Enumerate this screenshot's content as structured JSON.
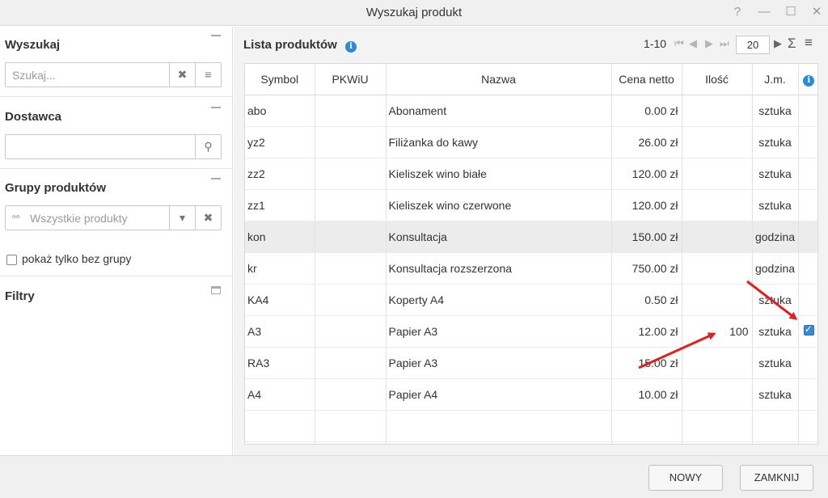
{
  "window": {
    "title": "Wyszukaj produkt",
    "help": "?",
    "minimize": "—",
    "maximize": "☐",
    "close": "✕"
  },
  "left": {
    "search": {
      "title": "Wyszukaj",
      "placeholder": "Szukaj...",
      "clear": "✖",
      "menu": "≡"
    },
    "supplier": {
      "title": "Dostawca",
      "value": "",
      "search": "⚲"
    },
    "groups": {
      "title": "Grupy produktów",
      "value": "Wszystkie produkty",
      "dropdown": "▾",
      "clear": "✖"
    },
    "only_no_group": "pokaż tylko bez grupy",
    "filters": {
      "title": "Filtry"
    }
  },
  "list": {
    "title": "Lista produktów",
    "info": "i",
    "range": "1-10",
    "page_size": "20",
    "sum": "Σ",
    "menu": "≡"
  },
  "table": {
    "headers": [
      "Symbol",
      "PKWiU",
      "Nazwa",
      "Cena netto",
      "Ilość",
      "J.m.",
      "i"
    ],
    "rows": [
      {
        "symbol": "abo",
        "pkwiu": "",
        "name": "Abonament",
        "price": "0.00 zł",
        "qty": "",
        "unit": "sztuka",
        "checked": false
      },
      {
        "symbol": "yz2",
        "pkwiu": "",
        "name": "Filiżanka do kawy",
        "price": "26.00 zł",
        "qty": "",
        "unit": "sztuka",
        "checked": false
      },
      {
        "symbol": "zz2",
        "pkwiu": "",
        "name": "Kieliszek wino białe",
        "price": "120.00 zł",
        "qty": "",
        "unit": "sztuka",
        "checked": false
      },
      {
        "symbol": "zz1",
        "pkwiu": "",
        "name": "Kieliszek wino czerwone",
        "price": "120.00 zł",
        "qty": "",
        "unit": "sztuka",
        "checked": false
      },
      {
        "symbol": "kon",
        "pkwiu": "",
        "name": "Konsultacja",
        "price": "150.00 zł",
        "qty": "",
        "unit": "godzina",
        "checked": false
      },
      {
        "symbol": "kr",
        "pkwiu": "",
        "name": "Konsultacja rozszerzona",
        "price": "750.00 zł",
        "qty": "",
        "unit": "godzina",
        "checked": false
      },
      {
        "symbol": "KA4",
        "pkwiu": "",
        "name": "Koperty A4",
        "price": "0.50 zł",
        "qty": "",
        "unit": "sztuka",
        "checked": false
      },
      {
        "symbol": "A3",
        "pkwiu": "",
        "name": "Papier A3",
        "price": "12.00 zł",
        "qty": "100",
        "unit": "sztuka",
        "checked": true
      },
      {
        "symbol": "RA3",
        "pkwiu": "",
        "name": "Papier A3",
        "price": "15.00 zł",
        "qty": "",
        "unit": "sztuka",
        "checked": false
      },
      {
        "symbol": "A4",
        "pkwiu": "",
        "name": "Papier A4",
        "price": "10.00 zł",
        "qty": "",
        "unit": "sztuka",
        "checked": false
      }
    ]
  },
  "footer": {
    "new": "NOWY",
    "close": "ZAMKNIJ"
  },
  "colors": {
    "accent": "#2c8bd6",
    "arrow": "#e02020",
    "selected_row": "#ececec"
  }
}
